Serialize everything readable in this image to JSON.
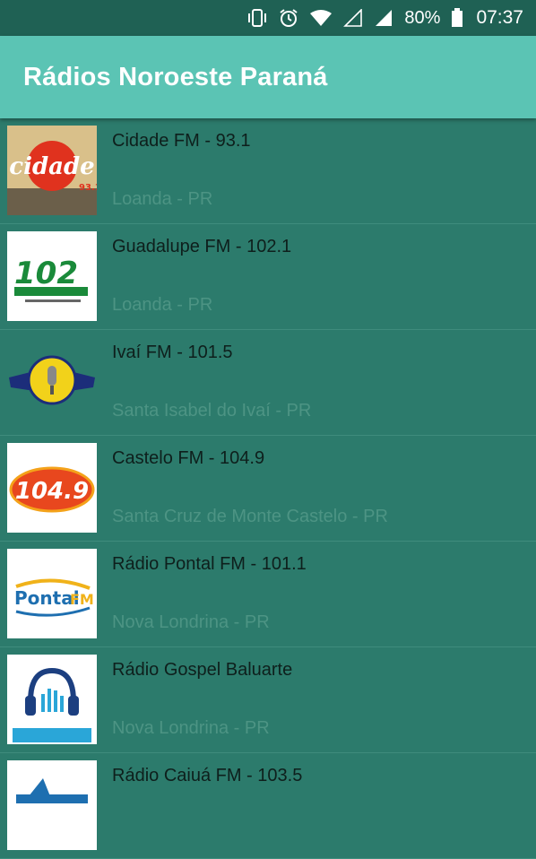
{
  "status_bar": {
    "battery": "80%",
    "time": "07:37",
    "icons": [
      "vibrate-icon",
      "alarm-icon",
      "wifi-icon",
      "signal-empty-icon",
      "signal-icon",
      "battery-icon"
    ]
  },
  "app_bar": {
    "title": "Rádios Noroeste Paraná"
  },
  "stations": [
    {
      "name": "Cidade FM - 93.1",
      "city": "Loanda - PR",
      "logo": "cidade-fm-logo"
    },
    {
      "name": "Guadalupe FM - 102.1",
      "city": "Loanda - PR",
      "logo": "guadalupe-fm-logo"
    },
    {
      "name": "Ivaí FM - 101.5",
      "city": "Santa Isabel do Ivaí - PR",
      "logo": "ivai-fm-logo"
    },
    {
      "name": "Castelo FM - 104.9",
      "city": "Santa Cruz de Monte Castelo - PR",
      "logo": "castelo-fm-logo"
    },
    {
      "name": "Rádio Pontal FM - 101.1",
      "city": "Nova Londrina - PR",
      "logo": "pontal-fm-logo"
    },
    {
      "name": "Rádio Gospel Baluarte",
      "city": "Nova Londrina - PR",
      "logo": "gospel-baluarte-logo"
    },
    {
      "name": "Rádio Caiuá FM - 103.5",
      "city": "",
      "logo": "caiua-fm-logo"
    }
  ],
  "colors": {
    "status_bar": "#1f6154",
    "app_bar": "#5bc4b4",
    "list_background": "#2c7b6c",
    "station_name": "#0e1f1c",
    "station_city": "#4d9484"
  }
}
